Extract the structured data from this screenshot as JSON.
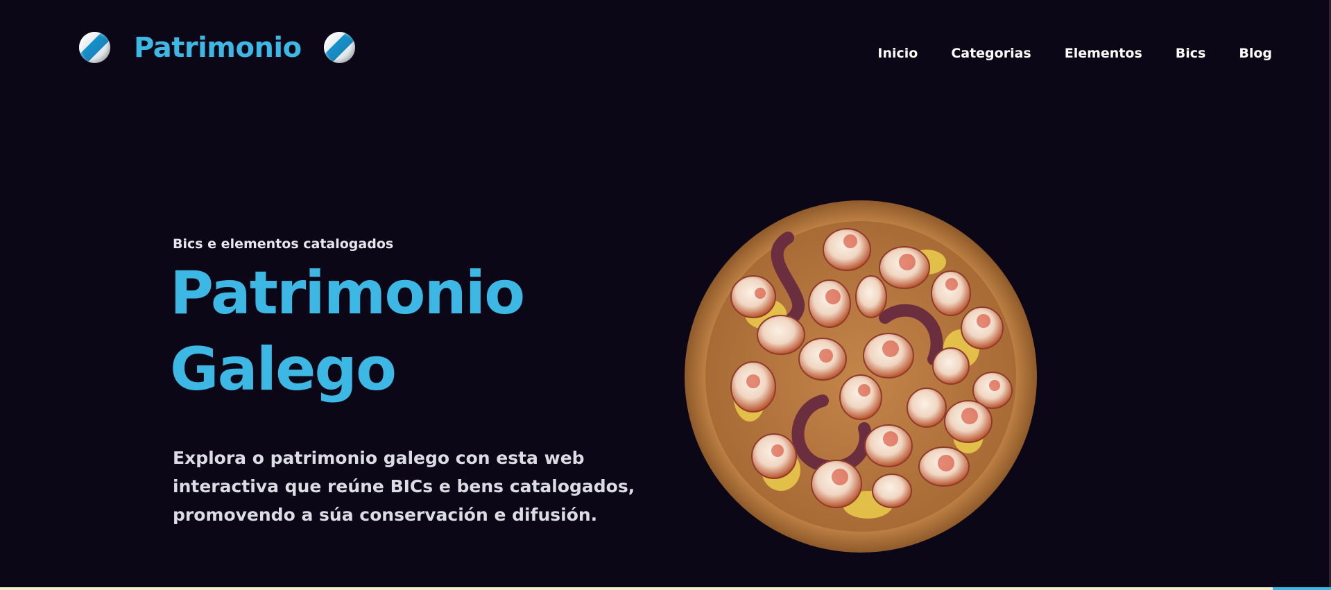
{
  "brand": {
    "name": "Patrimonio",
    "flag_icon": "galician-flag-icon"
  },
  "nav": {
    "items": [
      {
        "label": "Inicio"
      },
      {
        "label": "Categorias"
      },
      {
        "label": "Elementos"
      },
      {
        "label": "Bics"
      },
      {
        "label": "Blog"
      }
    ]
  },
  "hero": {
    "eyebrow": "Bics e elementos catalogados",
    "title_line1": "Patrimonio",
    "title_line2": "Galego",
    "description_line1": "Explora o patrimonio galego con esta web",
    "description_line2": "interactiva que reúne BICs e bens catalogados,",
    "description_line3": "promovendo a súa conservación e difusión.",
    "image_icon": "pulpo-a-feira-dish-image"
  },
  "colors": {
    "background": "#0c0716",
    "accent": "#3db7e3",
    "text": "#ffffff",
    "footer_strip": "#f4eecb"
  }
}
